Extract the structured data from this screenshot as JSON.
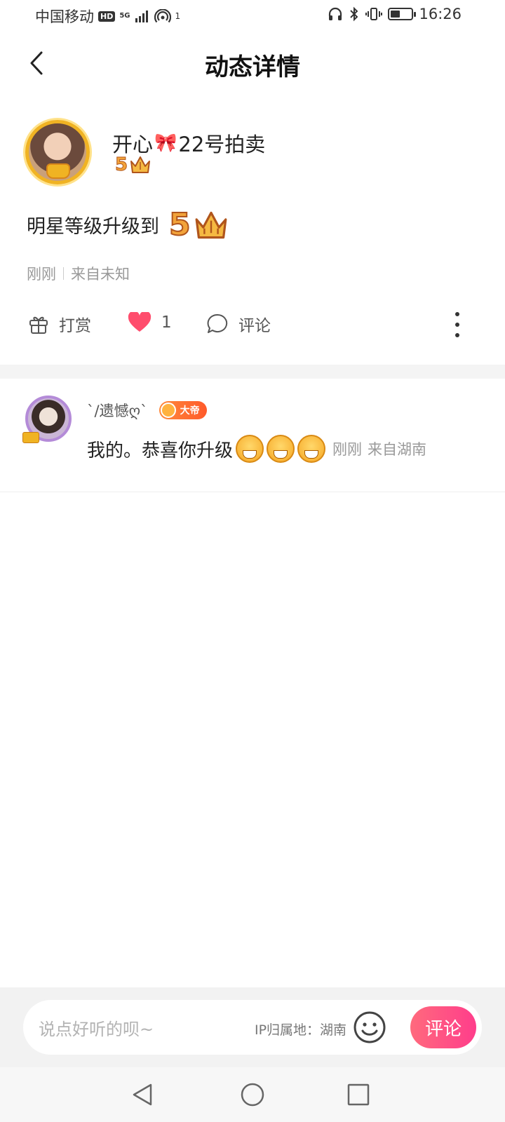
{
  "status_bar": {
    "carrier": "中国移动",
    "hd": "HD",
    "network": "5G",
    "hotspot_count": "1",
    "battery_level": 0.45,
    "time": "16:26"
  },
  "header": {
    "title": "动态详情"
  },
  "post": {
    "username_part1": "开心",
    "username_emoji": "🎀",
    "username_part2": "22号拍卖",
    "level": "5",
    "content_text": "明星等级升级到",
    "content_level": "5",
    "time": "刚刚",
    "source": "来自未知",
    "actions": {
      "reward_label": "打赏",
      "like_count": "1",
      "comment_label": "评论"
    }
  },
  "comments": [
    {
      "name": "`/遗憾ღ`",
      "rank": "大帝",
      "text": "我的。恭喜你升级",
      "emoji_count": 3,
      "time": "刚刚",
      "location": "来自湖南"
    }
  ],
  "input_bar": {
    "placeholder": "说点好听的呗~",
    "ip_label": "IP归属地：湖南",
    "send_label": "评论"
  },
  "colors": {
    "accent_pink": "#ff3d8b",
    "like_red": "#ff4d6d",
    "gold": "#f0b323"
  }
}
